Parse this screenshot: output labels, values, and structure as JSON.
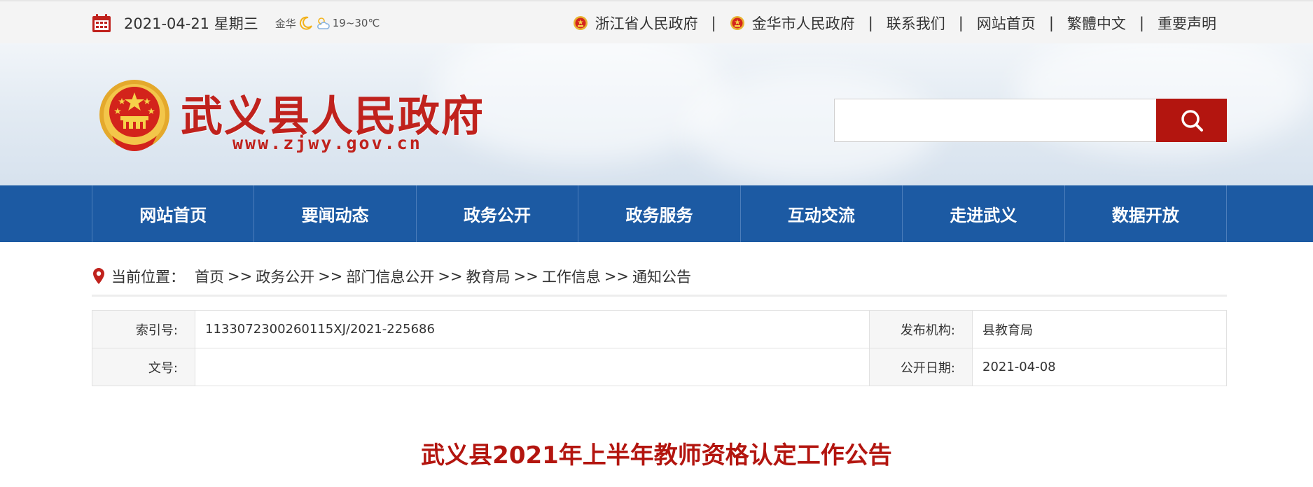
{
  "topbar": {
    "date": "2021-04-21 星期三",
    "weather_city": "金华",
    "weather_temp": "19~30℃",
    "links": [
      {
        "label": "浙江省人民政府",
        "emblem": true
      },
      {
        "label": "金华市人民政府",
        "emblem": true
      },
      {
        "label": "联系我们",
        "emblem": false
      },
      {
        "label": "网站首页",
        "emblem": false
      },
      {
        "label": "繁體中文",
        "emblem": false
      },
      {
        "label": "重要声明",
        "emblem": false
      }
    ],
    "separator": "|"
  },
  "header": {
    "title": "武义县人民政府",
    "url": "www.zjwy.gov.cn",
    "search_placeholder": "",
    "search_icon": "search-icon"
  },
  "nav": {
    "items": [
      "网站首页",
      "要闻动态",
      "政务公开",
      "政务服务",
      "互动交流",
      "走进武义",
      "数据开放"
    ]
  },
  "breadcrumb": {
    "label": "当前位置：",
    "items": [
      "首页",
      "政务公开",
      "部门信息公开",
      "教育局",
      "工作信息",
      "通知公告"
    ],
    "separator": ">>"
  },
  "info": {
    "index_label": "索引号:",
    "index_value": "1133072300260115XJ/2021-225686",
    "org_label": "发布机构:",
    "org_value": "县教育局",
    "docno_label": "文号:",
    "docno_value": "",
    "date_label": "公开日期:",
    "date_value": "2021-04-08"
  },
  "article": {
    "title": "武义县2021年上半年教师资格认定工作公告"
  },
  "colors": {
    "brand_red": "#c0221d",
    "nav_blue": "#1c5aa3",
    "search_button": "#b3150f"
  }
}
